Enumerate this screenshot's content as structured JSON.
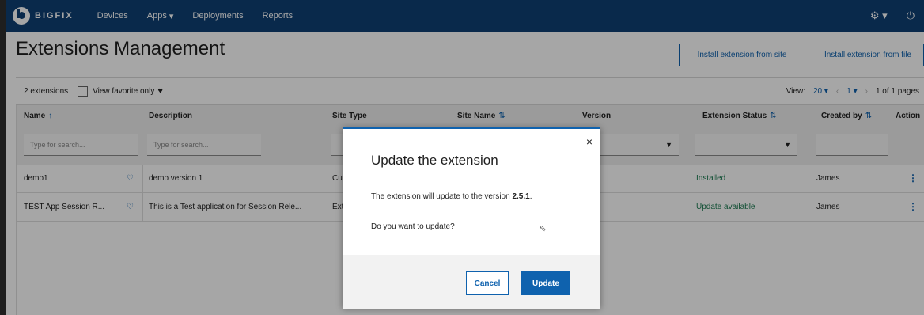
{
  "nav": {
    "logo": "BIGFIX",
    "items": [
      {
        "label": "Devices"
      },
      {
        "label": "Apps",
        "caret": "▾"
      },
      {
        "label": "Deployments"
      },
      {
        "label": "Reports"
      }
    ],
    "settings_icon": "gear-icon",
    "power_icon": "power-icon"
  },
  "header": {
    "title": "Extensions Management",
    "install_site_label": "Install extension from site",
    "install_file_label": "Install extension from file"
  },
  "toolbar": {
    "count": "2 extensions",
    "favorite_label": "View favorite only",
    "view_label": "View:",
    "page_size": "20",
    "page": "1",
    "pages_label": "1 of 1 pages"
  },
  "table": {
    "columns": [
      "Name",
      "Description",
      "Site Type",
      "Site Name",
      "Version",
      "Extension Status",
      "Created by",
      "Action"
    ],
    "name_sort": "↑",
    "sort_icon": "⇅",
    "name_placeholder": "Type for search...",
    "desc_placeholder": "Type for search...",
    "rows": [
      {
        "name": "demo1",
        "description": "demo version 1",
        "site_type": "Cust",
        "status": "Installed",
        "created_by": "James"
      },
      {
        "name": "TEST App Session R...",
        "description": "This is a Test application for Session Rele...",
        "site_type": "Exter",
        "status": "Update available",
        "created_by": "James"
      }
    ]
  },
  "modal": {
    "title": "Update the extension",
    "message_prefix": "The extension will update to the version ",
    "version": "2.5.1",
    "message_suffix": ".",
    "question": "Do you want to update?",
    "cancel_label": "Cancel",
    "update_label": "Update",
    "close": "×"
  }
}
